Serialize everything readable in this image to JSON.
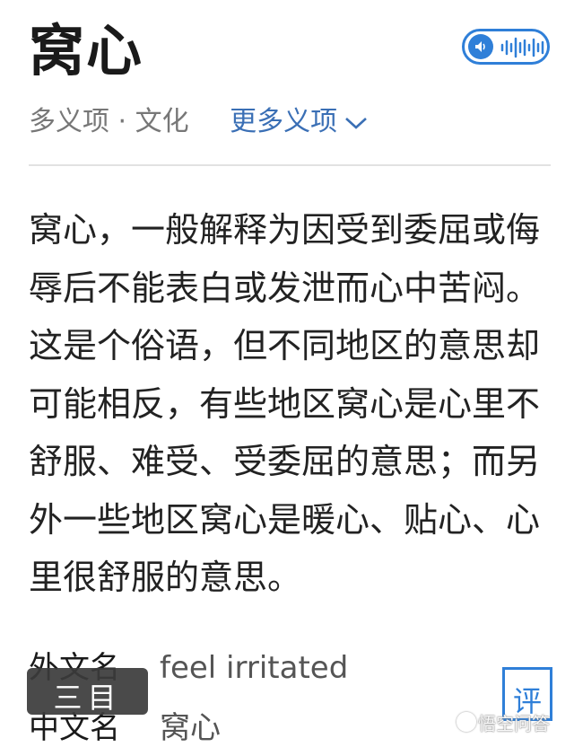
{
  "entry": {
    "title": "窝心",
    "sense_label": "多义项 · 文化",
    "more_senses_label": "更多义项"
  },
  "summary": "窝心，一般解释为因受到委屈或侮辱后不能表白或发泄而心中苦闷。这是个俗语，但不同地区的意思却可能相反，有些地区窝心是心里不舒服、难受、受委屈的意思；而另外一些地区窝心是暖心、贴心、心里很舒服的意思。",
  "basic_info": [
    {
      "key": "外文名",
      "value": "feel irritated"
    },
    {
      "key": "中文名",
      "value": "窝心"
    }
  ],
  "buttons": {
    "catalog": "三目",
    "comment": "评"
  },
  "watermark": "悟空问答",
  "icons": {
    "audio": "speaker-icon",
    "more": "chevron-down-icon"
  },
  "colors": {
    "accent": "#2f7fd8",
    "link": "#3a6fb5"
  }
}
